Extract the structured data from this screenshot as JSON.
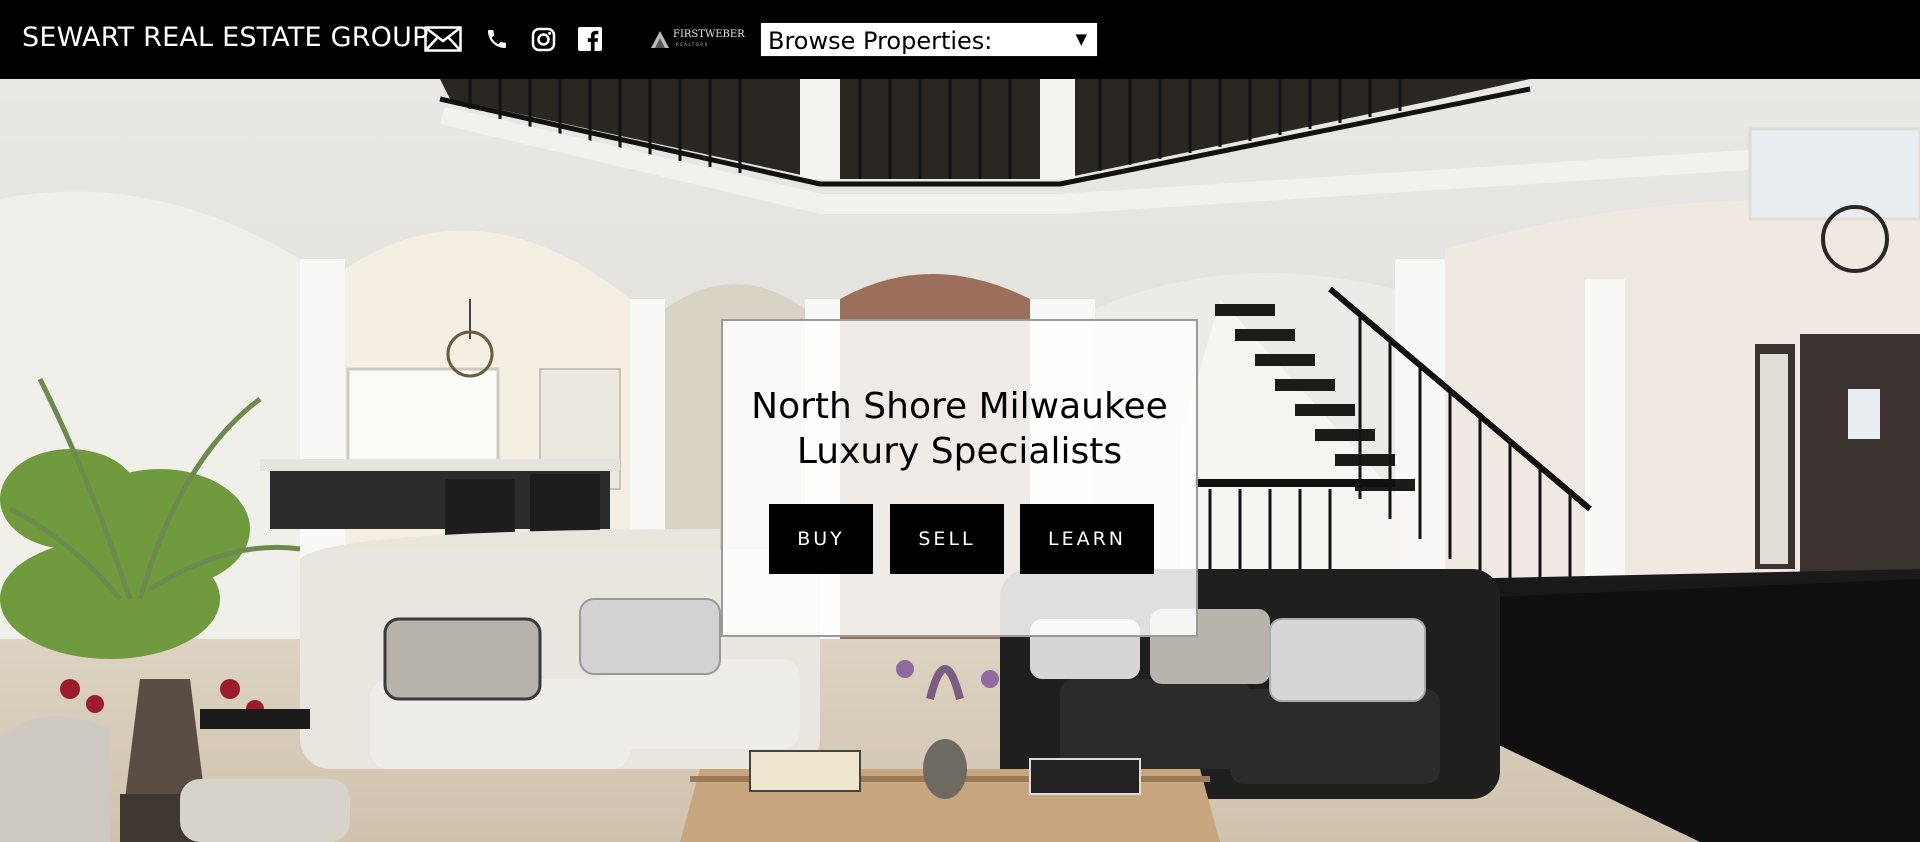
{
  "header": {
    "brand": "SEWART REAL ESTATE GROUP",
    "icons": [
      "mail-icon",
      "phone-icon",
      "instagram-icon",
      "facebook-icon"
    ],
    "partner_logo": "FIRSTWEBER",
    "partner_logo_sub": "REALTORS",
    "browse": {
      "label": "Browse Properties:",
      "caret": "▼"
    }
  },
  "hero_card": {
    "title_line1": "North Shore Milwaukee",
    "title_line2": "Luxury Specialists",
    "buttons": {
      "buy": "BUY",
      "sell": "SELL",
      "learn": "LEARN"
    }
  },
  "colors": {
    "bar": "#000000",
    "button_bg": "#000000",
    "button_text": "#ffffff",
    "card_bg": "#ffffff"
  }
}
